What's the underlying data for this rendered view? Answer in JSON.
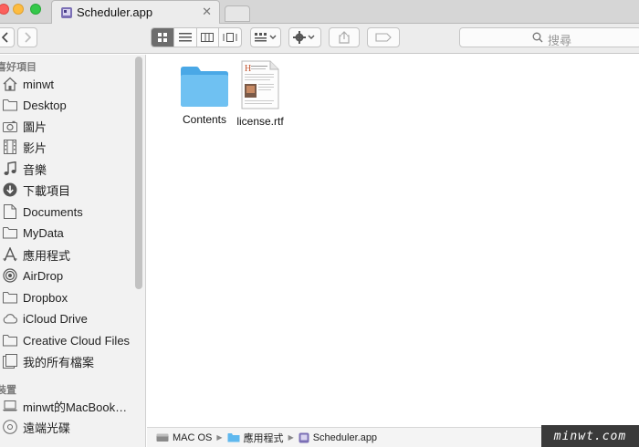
{
  "window": {
    "tab_title": "Scheduler.app",
    "tab_close_glyph": "✕"
  },
  "toolbar": {
    "back_icon": "chevron-left-icon",
    "forward_icon": "chevron-right-icon",
    "views": [
      "icon-view",
      "list-view",
      "column-view",
      "coverflow-view"
    ],
    "active_view": "icon-view",
    "search_placeholder": "搜尋"
  },
  "sidebar": {
    "favorites_header": "喜好項目",
    "devices_header": "裝置",
    "favorites": [
      {
        "label": "minwt",
        "icon": "home-icon"
      },
      {
        "label": "Desktop",
        "icon": "folder-icon"
      },
      {
        "label": "圖片",
        "icon": "camera-icon"
      },
      {
        "label": "影片",
        "icon": "film-icon"
      },
      {
        "label": "音樂",
        "icon": "music-note-icon"
      },
      {
        "label": "下載項目",
        "icon": "download-icon"
      },
      {
        "label": "Documents",
        "icon": "document-icon"
      },
      {
        "label": "MyData",
        "icon": "folder-icon"
      },
      {
        "label": "應用程式",
        "icon": "applications-icon"
      },
      {
        "label": "AirDrop",
        "icon": "airdrop-icon"
      },
      {
        "label": "Dropbox",
        "icon": "folder-icon"
      },
      {
        "label": "iCloud Drive",
        "icon": "cloud-icon"
      },
      {
        "label": "Creative Cloud Files",
        "icon": "folder-icon"
      },
      {
        "label": "我的所有檔案",
        "icon": "all-files-icon"
      }
    ],
    "devices": [
      {
        "label": "minwt的MacBook…",
        "icon": "laptop-icon"
      },
      {
        "label": "遠端光碟",
        "icon": "disc-icon"
      }
    ]
  },
  "content": {
    "items": [
      {
        "label": "Contents",
        "icon": "folder-icon"
      },
      {
        "label": "license.rtf",
        "icon": "rtf-document-icon"
      }
    ]
  },
  "pathbar": {
    "crumbs": [
      {
        "label": "MAC OS",
        "icon": "hard-drive-icon"
      },
      {
        "label": "應用程式",
        "icon": "folder-icon"
      },
      {
        "label": "Scheduler.app",
        "icon": "app-icon"
      }
    ],
    "separator": "▶"
  },
  "watermark": {
    "text": "minwt.com"
  },
  "colors": {
    "folder_blue": "#5fb8ee",
    "sidebar_bg": "#f2f2f2",
    "toolbar_bg": "#ececec"
  }
}
